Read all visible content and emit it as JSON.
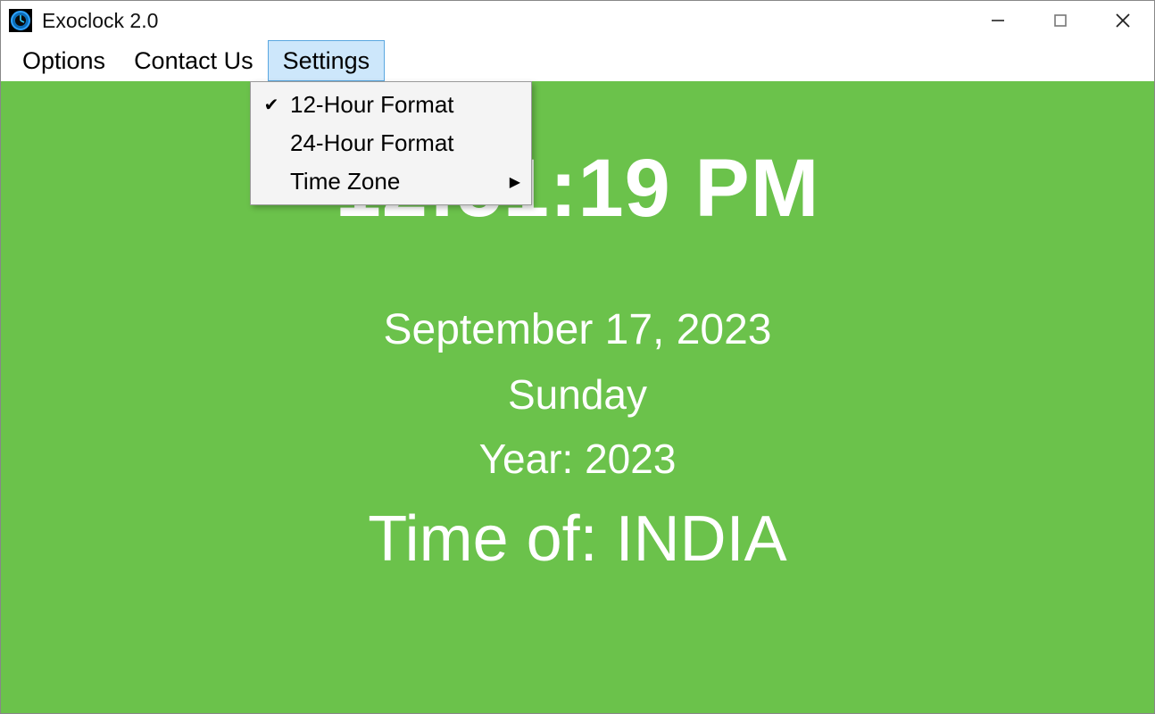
{
  "titlebar": {
    "app_title": "Exoclock 2.0"
  },
  "menubar": {
    "items": [
      {
        "label": "Options",
        "active": false
      },
      {
        "label": "Contact Us",
        "active": false
      },
      {
        "label": "Settings",
        "active": true
      }
    ]
  },
  "dropdown": {
    "items": [
      {
        "label": "12-Hour Format",
        "checked": true,
        "has_submenu": false
      },
      {
        "label": "24-Hour Format",
        "checked": false,
        "has_submenu": false
      },
      {
        "label": "Time Zone",
        "checked": false,
        "has_submenu": true
      }
    ]
  },
  "display": {
    "time": "12:51:19 PM",
    "date": "September 17, 2023",
    "day": "Sunday",
    "year_line": "Year: 2023",
    "tz_line": "Time of: INDIA"
  },
  "colors": {
    "content_bg": "#6bc24b",
    "menu_highlight_bg": "#cde7fb",
    "menu_highlight_border": "#5aa7e0"
  }
}
